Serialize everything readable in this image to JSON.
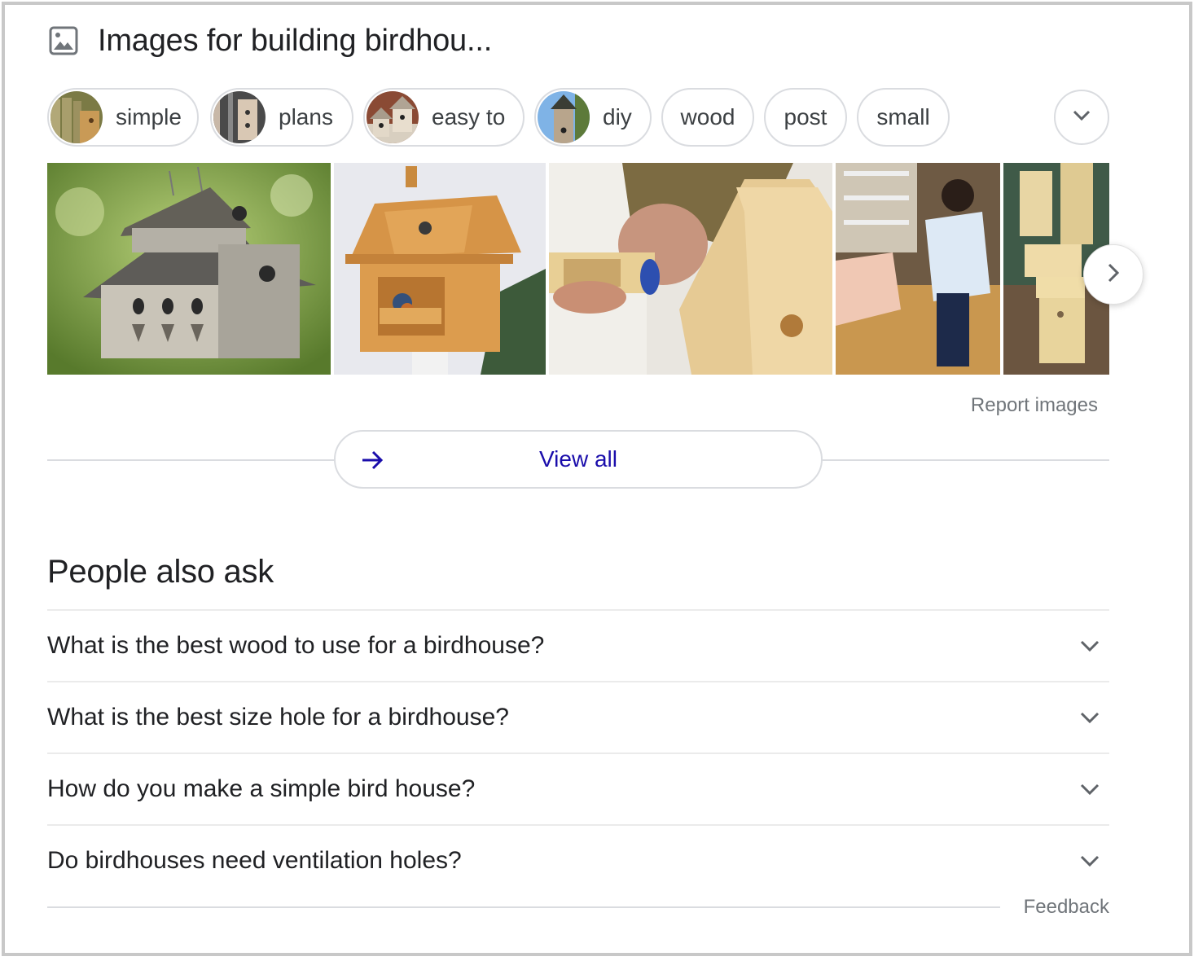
{
  "header": {
    "icon": "image-icon",
    "title": "Images for building birdhou..."
  },
  "chips": [
    {
      "label": "simple",
      "has_thumbnail": true
    },
    {
      "label": "plans",
      "has_thumbnail": true
    },
    {
      "label": "easy to",
      "has_thumbnail": true
    },
    {
      "label": "diy",
      "has_thumbnail": true
    },
    {
      "label": "wood",
      "has_thumbnail": false
    },
    {
      "label": "post",
      "has_thumbnail": false
    },
    {
      "label": "small",
      "has_thumbnail": false
    }
  ],
  "chips_more": {
    "icon": "chevron-down-icon"
  },
  "images": [
    {
      "description": "Weathered gray multi-hole hanging birdhouse with shingle roof"
    },
    {
      "description": "Cedar two-story birdhouse with porch and bluebird on a post"
    },
    {
      "description": "Hand applying wood glue to a pine birdhouse panel"
    },
    {
      "description": "Child assembling a wooden birdhouse in a workshop"
    },
    {
      "description": "Stack of unfinished wooden birdhouses on a patterned rug"
    }
  ],
  "next_button": {
    "icon": "chevron-right-icon"
  },
  "report_images": "Report images",
  "view_all": {
    "label": "View all",
    "icon": "arrow-right-icon"
  },
  "people_also_ask": {
    "title": "People also ask",
    "questions": [
      "What is the best wood to use for a birdhouse?",
      "What is the best size hole for a birdhouse?",
      "How do you make a simple bird house?",
      "Do birdhouses need ventilation holes?"
    ]
  },
  "feedback": "Feedback",
  "colors": {
    "link": "#1a0dab",
    "text": "#202124",
    "muted": "#70757a",
    "border": "#dadce0",
    "icon": "#5f6368"
  }
}
